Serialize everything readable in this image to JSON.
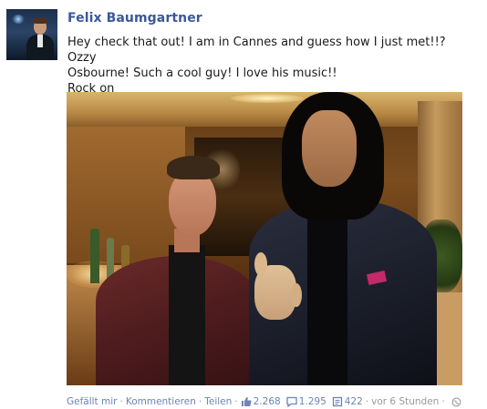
{
  "post": {
    "author": "Felix Baumgartner",
    "message_lines": [
      "Hey check that out! I am in Cannes and guess how I just met!!? Ozzy",
      "Osbourne! Such a cool guy! I love his music!!",
      "Rock on"
    ]
  },
  "footer": {
    "like_label": "Gefällt mir",
    "comment_label": "Kommentieren",
    "share_label": "Teilen",
    "separator": "·",
    "likes_count": "2.268",
    "comments_count": "1.295",
    "shares_count": "422",
    "timestamp": "vor 6 Stunden"
  },
  "icons": {
    "like": "thumbs-up-icon",
    "comment": "comment-bubble-icon",
    "share": "share-icon",
    "privacy": "globe-icon"
  },
  "colors": {
    "link": "#3b5998",
    "footer_link": "#6d84b4",
    "muted": "#999999"
  }
}
